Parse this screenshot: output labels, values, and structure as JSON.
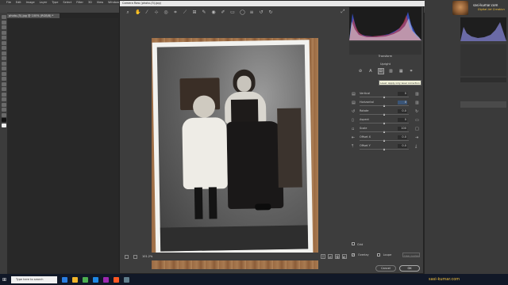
{
  "menubar": {
    "items": [
      "File",
      "Edit",
      "Image",
      "Layer",
      "Type",
      "Select",
      "Filter",
      "3D",
      "View",
      "Window",
      "Help"
    ]
  },
  "document_tab": {
    "label": "photo-(5).jpg @ 100% (RGB/8) *"
  },
  "camera_raw": {
    "title": "Camera Raw (photo-(5).jpg)",
    "zoom": "101.2%",
    "panel_title": "Transform",
    "upright_label": "Upright",
    "tooltip": "Level: Apply only level correction",
    "sliders": [
      {
        "label": "Vertical",
        "value": "0",
        "thumb": 0.5
      },
      {
        "label": "Horizontal",
        "value": "0",
        "thumb": 0.5,
        "focus": true
      },
      {
        "label": "Rotate",
        "value": "0.0",
        "thumb": 0.5
      },
      {
        "label": "Aspect",
        "value": "0",
        "thumb": 0.5
      },
      {
        "label": "Scale",
        "value": "100",
        "thumb": 0.5
      },
      {
        "label": "Offset X",
        "value": "0.0",
        "thumb": 0.5
      },
      {
        "label": "Offset Y",
        "value": "0.0",
        "thumb": 0.5
      }
    ],
    "grid_label": "Grid",
    "overlay_label": "Overlay",
    "loupe_label": "Loupe",
    "clear_guides_label": "Clear Guides",
    "cancel_label": "Cancel",
    "ok_label": "OK"
  },
  "branding": {
    "name": "sasi-kumar.com",
    "subtitle": "Digital Art Creation"
  },
  "taskbar": {
    "search_placeholder": "Type here to search"
  }
}
